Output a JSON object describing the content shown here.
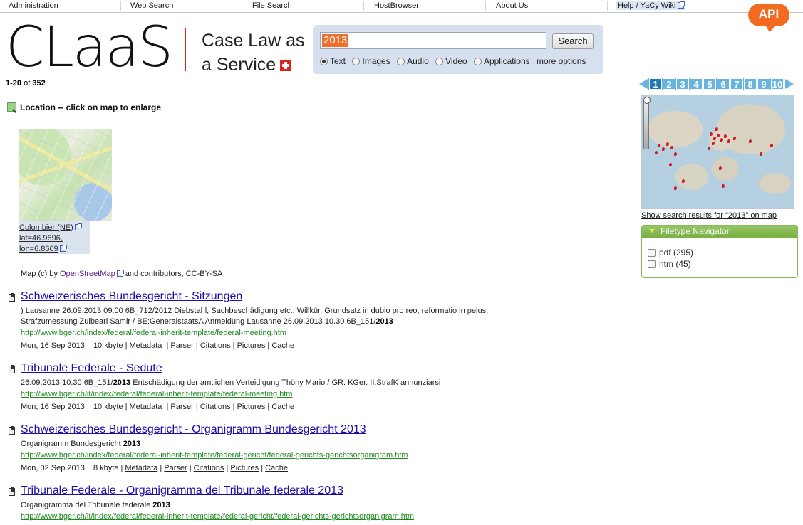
{
  "topnav": {
    "items": [
      "Administration",
      "Web Search",
      "File Search",
      "HostBrowser",
      "About Us",
      "Help / YaCy Wiki"
    ]
  },
  "api_badge": "API",
  "logo": {
    "wordmark": "CLaaS",
    "tagline_line1": "Case Law as",
    "tagline_line2": "a Service"
  },
  "search": {
    "query": "2013",
    "button_label": "Search",
    "content_types": [
      "Text",
      "Images",
      "Audio",
      "Video",
      "Applications"
    ],
    "selected_type": "Text",
    "more_options": "more options"
  },
  "results_count": {
    "range": "1-20",
    "of_label": "of",
    "total": "352"
  },
  "pager": {
    "pages": [
      "1",
      "2",
      "3",
      "4",
      "5",
      "6",
      "7",
      "8",
      "9",
      "10"
    ],
    "current": "1"
  },
  "location": {
    "title": "Location -- click on map to enlarge",
    "place": "Colombier (NE)",
    "lat": "lat=46.9696,",
    "lon": "lon=6.8609",
    "credit_prefix": "Map (c) by",
    "credit_link": "OpenStreetMap",
    "credit_suffix": "and contributors, CC-BY-SA"
  },
  "results": [
    {
      "title": "Schweizerisches Bundesgericht - Sitzungen",
      "snippet_lines": [
        ") Lausanne 26.09.2013 09.00 6B_712/2012 Diebstahl, Sachbeschädigung etc.; Willkür, Grundsatz in dubio pro reo, reformatio in peius;",
        "Strafzumessung Zulbeari Samir / BE:GeneralstaatsA Anmeldung Lausanne 26.09.2013 10.30 6B_151/"
      ],
      "snippet_bold": "2013",
      "url": "http://www.bger.ch/index/federal/federal-inherit-template/federal-meeting.htm",
      "date": "Mon, 16 Sep 2013",
      "size": "10 kbyte"
    },
    {
      "title": "Tribunale Federale - Sedute",
      "snippet_pre": "26.09.2013 10.30 6B_151/",
      "snippet_bold": "2013",
      "snippet_post": " Entschädigung der amtlichen Verteidigung Thöny Mario / GR: KGer. II.StrafK annunziarsi",
      "url": "http://www.bger.ch/it/index/federal/federal-inherit-template/federal-meeting.htm",
      "date": "Mon, 16 Sep 2013",
      "size": "10 kbyte"
    },
    {
      "title": "Schweizerisches Bundesgericht - Organigramm Bundesgericht 2013",
      "snippet_pre": "Organigramm Bundesgericht ",
      "snippet_bold": "2013",
      "url": "http://www.bger.ch/index/federal/federal-inherit-template/federal-gericht/federal-gerichts-gerichtsorganigram.htm",
      "date": "Mon, 02 Sep 2013",
      "size": "8 kbyte"
    },
    {
      "title": "Tribunale Federale - Organigramma del Tribunale federale 2013",
      "snippet_pre": "Organigramma del Tribunale federale ",
      "snippet_bold": "2013",
      "url": "http://www.bger.ch/it/index/federal/federal-inherit-template/federal-gericht/federal-gerichts-gerichtsorganigram.htm"
    }
  ],
  "result_actions": [
    "Metadata",
    "Parser",
    "Citations",
    "Pictures",
    "Cache"
  ],
  "sidebar": {
    "show_map_link": "Show search results for \"2013\" on map",
    "filetype_title": "Filetype Navigator",
    "filetypes": [
      {
        "label": "pdf (295)"
      },
      {
        "label": "htm (45)"
      }
    ]
  },
  "colors": {
    "link": "#1a0dab",
    "url_green": "#1e8b1e",
    "accent_orange": "#f36b20",
    "swiss_red": "#e0231d",
    "pager_blue": "#67b4e0",
    "nav_green": "#79b043"
  }
}
